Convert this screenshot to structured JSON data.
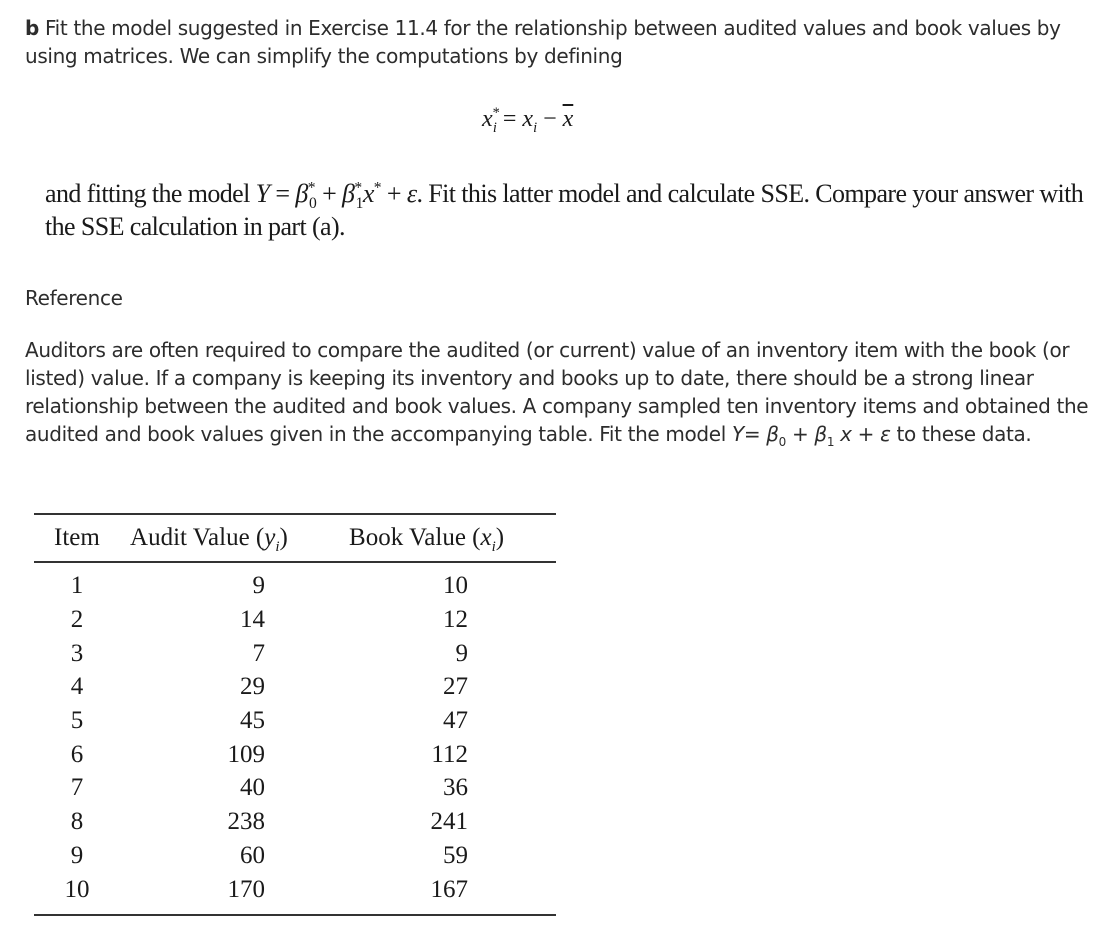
{
  "part_b": {
    "label": "b",
    "text": "Fit the model suggested in Exercise 11.4 for the relationship between audited values and book values by using matrices. We can simplify the computations by defining"
  },
  "formula": {
    "lhs_var": "x",
    "lhs_sub": "i",
    "lhs_sup": "*",
    "equals": "=",
    "rhs_var": "x",
    "rhs_sub": "i",
    "minus": "−",
    "mean_var": "x"
  },
  "model_text": {
    "before": "and fitting the model ",
    "Y": "Y",
    "eq": " = ",
    "beta": "β",
    "b0_sub": "0",
    "b1_sub": "1",
    "star": "*",
    "plus": " + ",
    "x": "x",
    "epsilon": "ε",
    "after": ". Fit this latter model and calculate SSE. Compare your answer with the SSE calculation in part (a)."
  },
  "reference": {
    "heading": "Reference",
    "text": "Auditors are often required to compare the audited (or current) value of an inventory item with the book (or listed) value. If a company is keeping its inventory and books up to date, there should be a strong linear relationship between the audited and book values. A company sampled ten inventory items and obtained the audited and book values given in the accompanying table. Fit the model ",
    "model": {
      "Y": "Y",
      "eq": "= ",
      "beta": "β",
      "b0_sub": "0",
      "b1_sub": "1",
      "plus": " + ",
      "x": "x",
      "epsilon": "ε"
    },
    "after": " to these data."
  },
  "table": {
    "headers": {
      "item": "Item",
      "audit": "Audit Value (",
      "audit_var": "y",
      "book": "Book Value (",
      "book_var": "x",
      "sub": "i",
      "close": ")"
    },
    "rows": [
      {
        "item": "1",
        "audit": "9",
        "book": "10"
      },
      {
        "item": "2",
        "audit": "14",
        "book": "12"
      },
      {
        "item": "3",
        "audit": "7",
        "book": "9"
      },
      {
        "item": "4",
        "audit": "29",
        "book": "27"
      },
      {
        "item": "5",
        "audit": "45",
        "book": "47"
      },
      {
        "item": "6",
        "audit": "109",
        "book": "112"
      },
      {
        "item": "7",
        "audit": "40",
        "book": "36"
      },
      {
        "item": "8",
        "audit": "238",
        "book": "241"
      },
      {
        "item": "9",
        "audit": "60",
        "book": "59"
      },
      {
        "item": "10",
        "audit": "170",
        "book": "167"
      }
    ]
  }
}
